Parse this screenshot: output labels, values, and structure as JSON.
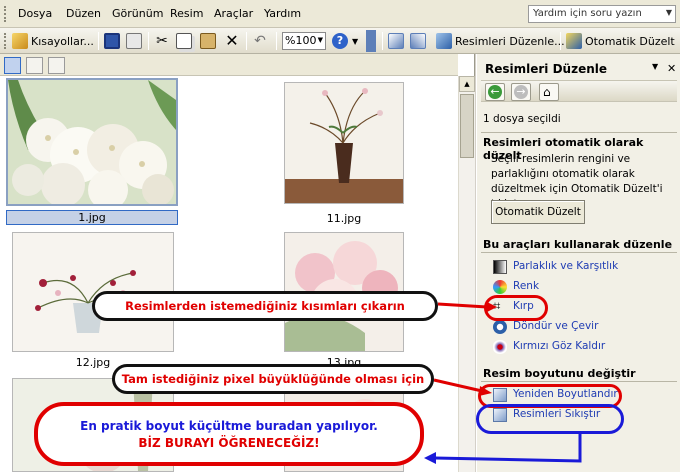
{
  "menu": [
    "Dosya",
    "Düzen",
    "Görünüm",
    "Resim",
    "Araçlar",
    "Yardım"
  ],
  "help_search": {
    "placeholder": "Yardım için soru yazın"
  },
  "toolbar": {
    "shortcuts_label": "Kısayollar...",
    "zoom_value": "%100",
    "edit_pictures_label": "Resimleri Düzenle...",
    "auto_fix_label": "Otomatik Düzelt"
  },
  "thumbnails": [
    {
      "caption": "1.jpg",
      "selected": true
    },
    {
      "caption": "11.jpg",
      "selected": false
    },
    {
      "caption": "12.jpg",
      "selected": false
    },
    {
      "caption": "13.jpg",
      "selected": false
    },
    {
      "caption": "",
      "selected": false
    },
    {
      "caption": "",
      "selected": false
    }
  ],
  "pane": {
    "title": "Resimleri Düzenle",
    "selection_count": "1 dosya seçildi",
    "auto_section_title": "Resimleri otomatik olarak düzelt",
    "auto_description": "Seçili resimlerin rengini ve parlaklığını otomatik olarak düzeltmek için Otomatik Düzelt'i tıklatın.",
    "auto_button": "Otomatik Düzelt",
    "tools_section_title": "Bu araçları kullanarak düzenle",
    "tools": [
      "Parlaklık ve Karşıtlık",
      "Renk",
      "Kırp",
      "Döndür ve Çevir",
      "Kırmızı Göz Kaldır"
    ],
    "resize_section_title": "Resim boyutunu değiştir",
    "resize_links": [
      "Yeniden Boyutlandır",
      "Resimleri Sıkıştır"
    ]
  },
  "annotations": {
    "crop_note": "Resimlerden istemediğiniz kısımları çıkarın",
    "resize_note": "Tam istediğiniz pixel büyüklüğünde olması için",
    "compress_note_line1": "En pratik boyut küçültme buradan yapılıyor.",
    "compress_note_line2": "BİZ BURAYI ÖĞRENECEĞİZ!"
  },
  "colors": {
    "annotation_red": "#e00000",
    "annotation_blue": "#1a1ad8",
    "link_blue": "#1f3cb3"
  }
}
